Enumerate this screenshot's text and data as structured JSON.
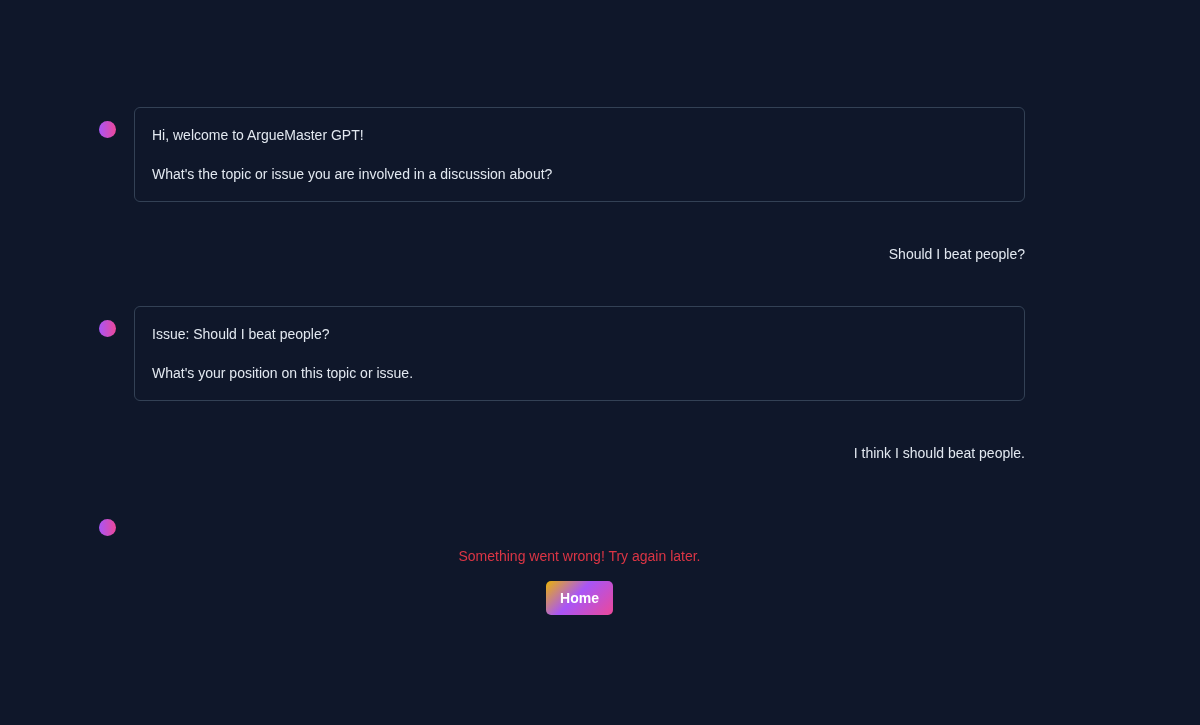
{
  "messages": [
    {
      "kind": "bot",
      "paragraphs": [
        "Hi, welcome to ArgueMaster GPT!",
        "What's the topic or issue you are involved in a discussion about?"
      ]
    },
    {
      "kind": "user",
      "text": "Should I beat people?"
    },
    {
      "kind": "bot",
      "paragraphs": [
        "Issue: Should I beat people?",
        "What's your position on this topic or issue."
      ]
    },
    {
      "kind": "user",
      "text": "I think I should beat people."
    },
    {
      "kind": "bot"
    }
  ],
  "error": {
    "text": "Something went wrong! Try again later."
  },
  "home_button": {
    "label": "Home"
  }
}
